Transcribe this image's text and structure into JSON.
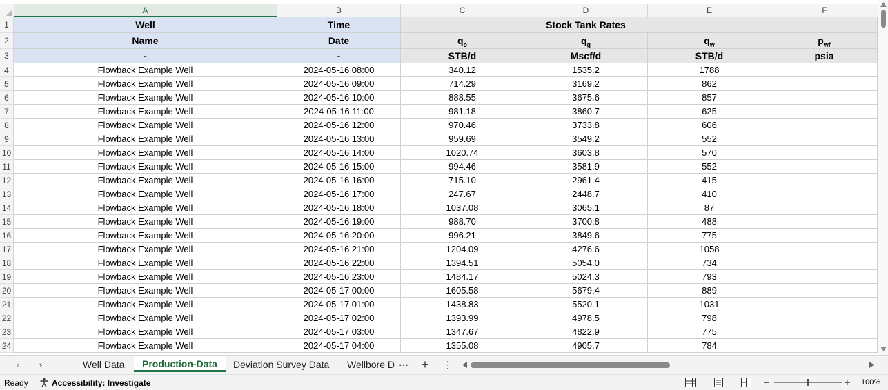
{
  "columns": [
    "A",
    "B",
    "C",
    "D",
    "E",
    "F"
  ],
  "rows_numbers": [
    "1",
    "2",
    "3",
    "4",
    "5",
    "6",
    "7",
    "8",
    "9",
    "10",
    "11",
    "12",
    "13",
    "14",
    "15",
    "16",
    "17",
    "18",
    "19",
    "20",
    "21",
    "22",
    "23",
    "24"
  ],
  "header": {
    "r1": {
      "well": "Well",
      "time": "Time",
      "stock": "Stock Tank Rates"
    },
    "r2": {
      "name": "Name",
      "date": "Date",
      "qo": {
        "base": "q",
        "sub": "o"
      },
      "qg": {
        "base": "q",
        "sub": "g"
      },
      "qw": {
        "base": "q",
        "sub": "w"
      },
      "pwf": {
        "base": "p",
        "sub": "wf"
      }
    },
    "r3": {
      "a": "-",
      "b": "-",
      "c": "STB/d",
      "d": "Mscf/d",
      "e": "STB/d",
      "f": "psia"
    }
  },
  "table_rows": [
    [
      "Flowback Example Well",
      "2024-05-16 08:00",
      "340.12",
      "1535.2",
      "1788"
    ],
    [
      "Flowback Example Well",
      "2024-05-16 09:00",
      "714.29",
      "3169.2",
      "862"
    ],
    [
      "Flowback Example Well",
      "2024-05-16 10:00",
      "888.55",
      "3675.6",
      "857"
    ],
    [
      "Flowback Example Well",
      "2024-05-16 11:00",
      "981.18",
      "3860.7",
      "625"
    ],
    [
      "Flowback Example Well",
      "2024-05-16 12:00",
      "970.46",
      "3733.8",
      "606"
    ],
    [
      "Flowback Example Well",
      "2024-05-16 13:00",
      "959.69",
      "3549.2",
      "552"
    ],
    [
      "Flowback Example Well",
      "2024-05-16 14:00",
      "1020.74",
      "3603.8",
      "570"
    ],
    [
      "Flowback Example Well",
      "2024-05-16 15:00",
      "994.46",
      "3581.9",
      "552"
    ],
    [
      "Flowback Example Well",
      "2024-05-16 16:00",
      "715.10",
      "2961.4",
      "415"
    ],
    [
      "Flowback Example Well",
      "2024-05-16 17:00",
      "247.67",
      "2448.7",
      "410"
    ],
    [
      "Flowback Example Well",
      "2024-05-16 18:00",
      "1037.08",
      "3065.1",
      "87"
    ],
    [
      "Flowback Example Well",
      "2024-05-16 19:00",
      "988.70",
      "3700.8",
      "488"
    ],
    [
      "Flowback Example Well",
      "2024-05-16 20:00",
      "996.21",
      "3849.6",
      "775"
    ],
    [
      "Flowback Example Well",
      "2024-05-16 21:00",
      "1204.09",
      "4276.6",
      "1058"
    ],
    [
      "Flowback Example Well",
      "2024-05-16 22:00",
      "1394.51",
      "5054.0",
      "734"
    ],
    [
      "Flowback Example Well",
      "2024-05-16 23:00",
      "1484.17",
      "5024.3",
      "793"
    ],
    [
      "Flowback Example Well",
      "2024-05-17 00:00",
      "1605.58",
      "5679.4",
      "889"
    ],
    [
      "Flowback Example Well",
      "2024-05-17 01:00",
      "1438.83",
      "5520.1",
      "1031"
    ],
    [
      "Flowback Example Well",
      "2024-05-17 02:00",
      "1393.99",
      "4978.5",
      "798"
    ],
    [
      "Flowback Example Well",
      "2024-05-17 03:00",
      "1347.67",
      "4822.9",
      "775"
    ],
    [
      "Flowback Example Well",
      "2024-05-17 04:00",
      "1355.08",
      "4905.7",
      "784"
    ]
  ],
  "sheet_tabs": [
    "Well Data",
    "Production-Data",
    "Deviation Survey Data",
    "Wellbore D"
  ],
  "active_tab": "Production-Data",
  "status": {
    "ready": "Ready",
    "accessibility": "Accessibility: Investigate",
    "zoom": "100%"
  },
  "colors": {
    "accent": "#217346",
    "header_blue": "#dae3f3",
    "header_gray": "#e7e6e6"
  }
}
